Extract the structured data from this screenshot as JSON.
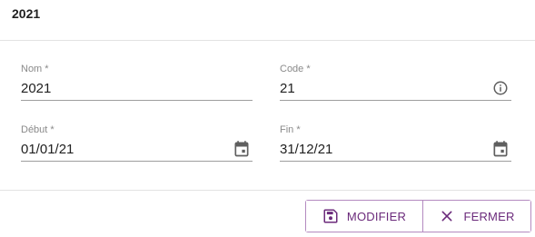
{
  "dialog": {
    "title": "2021"
  },
  "form": {
    "nom": {
      "label": "Nom",
      "required_mark": "*",
      "value": "2021"
    },
    "code": {
      "label": "Code",
      "required_mark": "*",
      "value": "21",
      "icon": "info-icon"
    },
    "debut": {
      "label": "Début",
      "required_mark": "*",
      "value": "01/01/21",
      "icon": "calendar-icon"
    },
    "fin": {
      "label": "Fin",
      "required_mark": "*",
      "value": "31/12/21",
      "icon": "calendar-icon"
    }
  },
  "actions": {
    "modify": {
      "label": "MODIFIER",
      "icon": "save-icon"
    },
    "close": {
      "label": "FERMER",
      "icon": "close-icon"
    }
  },
  "colors": {
    "accent": "#6b2a7b",
    "button_border": "#b48ac0",
    "icon_gray": "#5f5f5f",
    "label_gray": "#8a8a8a",
    "underline": "#9e9e9e"
  }
}
